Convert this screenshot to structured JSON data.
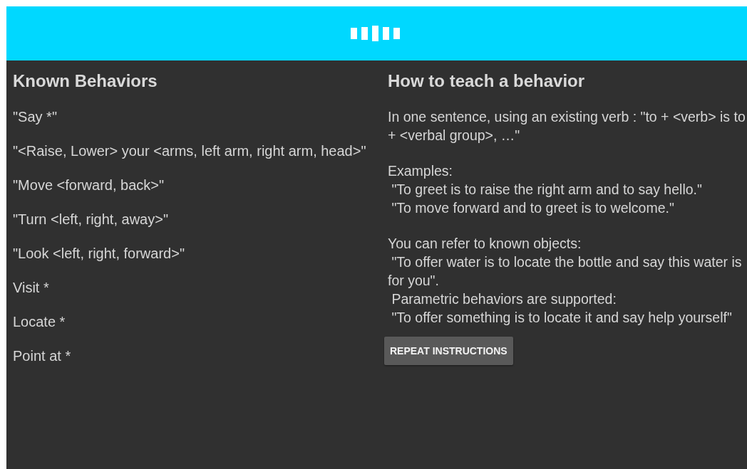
{
  "known_behaviors": {
    "title": "Known Behaviors",
    "items": [
      "\"Say *\"",
      "\"<Raise, Lower> your <arms, left arm, right arm, head>\"",
      "\"Move <forward, back>\"",
      "\"Turn <left, right, away>\"",
      "\"Look <left, right, forward>\"",
      "Visit *",
      "Locate *",
      "Point at *"
    ]
  },
  "how_to_teach": {
    "title": "How to teach a behavior",
    "paragraphs": [
      [
        "In one sentence, using an existing verb : \"to + <verb> is to + <verbal group>, …\""
      ],
      [
        "Examples:",
        " \"To greet is to raise the right arm and to say hello.\"",
        " \"To move forward and to greet is to welcome.\""
      ],
      [
        "You can refer to known objects:",
        " \"To offer water is to locate the bottle and say this water is for you\".",
        " Parametric behaviors are supported:",
        " \"To offer something is to locate it and say help yourself\""
      ]
    ],
    "button": "REPEAT INSTRUCTIONS"
  }
}
